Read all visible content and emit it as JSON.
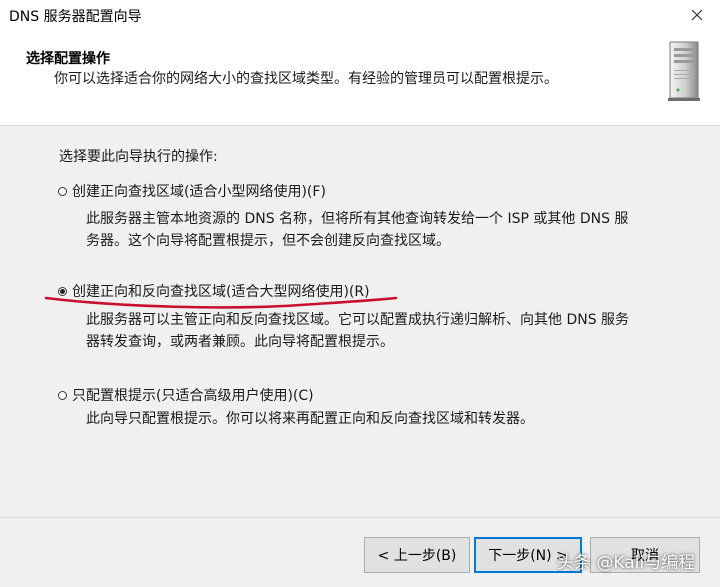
{
  "window": {
    "title": "DNS 服务器配置向导"
  },
  "header": {
    "title": "选择配置操作",
    "subtitle": "你可以选择适合你的网络大小的查找区域类型。有经验的管理员可以配置根提示。"
  },
  "prompt": "选择要此向导执行的操作:",
  "options": [
    {
      "label": "创建正向查找区域(适合小型网络使用)(F)",
      "selected": false,
      "description": [
        "此服务器主管本地资源的 DNS 名称，但将所有其他查询转发给一个 ISP 或其他 DNS 服",
        "务器。这个向导将配置根提示，但不会创建反向查找区域。"
      ]
    },
    {
      "label": "创建正向和反向查找区域(适合大型网络使用)(R)",
      "selected": true,
      "description": [
        "此服务器可以主管正向和反向查找区域。它可以配置成执行递归解析、向其他 DNS 服务",
        "器转发查询，或两者兼顾。此向导将配置根提示。"
      ]
    },
    {
      "label": "只配置根提示(只适合高级用户使用)(C)",
      "selected": false,
      "description": [
        "此向导只配置根提示。你可以将来再配置正向和反向查找区域和转发器。"
      ]
    }
  ],
  "buttons": {
    "back": "< 上一步(B)",
    "next": "下一步(N) >",
    "cancel": "取消"
  },
  "watermark": "头条 @Kali与编程",
  "colors": {
    "annotation": "#c8102e",
    "focus": "#0078d7"
  },
  "icons": {
    "close": "close-icon",
    "server": "server-icon"
  }
}
